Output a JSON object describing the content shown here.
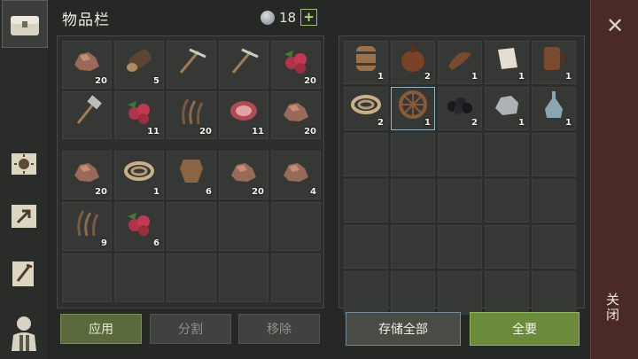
{
  "header": {
    "title": "物品栏",
    "currency_amount": "18",
    "add_label": "+"
  },
  "sidebar": {
    "tabs": [
      {
        "name": "inventory-chest"
      },
      {
        "name": "daily-sun"
      },
      {
        "name": "map-arrow"
      },
      {
        "name": "crafting-scroll"
      },
      {
        "name": "character"
      }
    ]
  },
  "left_top_slots": [
    {
      "item": "copper-ore-icon",
      "qty": "20"
    },
    {
      "item": "log-icon",
      "qty": "5"
    },
    {
      "item": "pickaxe-icon",
      "qty": ""
    },
    {
      "item": "pickaxe-icon",
      "qty": ""
    },
    {
      "item": "berries-icon",
      "qty": "20"
    },
    {
      "item": "hammer-icon",
      "qty": ""
    },
    {
      "item": "berries-icon",
      "qty": "11"
    },
    {
      "item": "plant-fiber-icon",
      "qty": "20"
    },
    {
      "item": "raw-meat-icon",
      "qty": "11"
    },
    {
      "item": "copper-ore-icon",
      "qty": "20"
    }
  ],
  "left_bottom_slots": [
    {
      "item": "copper-ore-icon",
      "qty": "20"
    },
    {
      "item": "rope-icon",
      "qty": "1"
    },
    {
      "item": "leather-icon",
      "qty": "6"
    },
    {
      "item": "copper-ore-icon",
      "qty": "20"
    },
    {
      "item": "copper-ore-icon",
      "qty": "4"
    },
    {
      "item": "plant-fiber-icon",
      "qty": "9"
    },
    {
      "item": "berries-icon",
      "qty": "6"
    },
    {
      "item": "",
      "qty": ""
    },
    {
      "item": "",
      "qty": ""
    },
    {
      "item": "",
      "qty": ""
    },
    {
      "item": "",
      "qty": ""
    },
    {
      "item": "",
      "qty": ""
    },
    {
      "item": "",
      "qty": ""
    },
    {
      "item": "",
      "qty": ""
    },
    {
      "item": "",
      "qty": ""
    }
  ],
  "right_slots": [
    {
      "item": "barrel-icon",
      "qty": "1"
    },
    {
      "item": "leather-flask-icon",
      "qty": "2"
    },
    {
      "item": "leather-strips-icon",
      "qty": "1"
    },
    {
      "item": "cloth-icon",
      "qty": "1"
    },
    {
      "item": "leather-mug-icon",
      "qty": "1"
    },
    {
      "item": "rope-icon",
      "qty": "2"
    },
    {
      "item": "wooden-wheel-icon",
      "qty": "1"
    },
    {
      "item": "coal-icon",
      "qty": "2"
    },
    {
      "item": "stone-icon",
      "qty": "1"
    },
    {
      "item": "glass-bottle-icon",
      "qty": "1"
    }
  ],
  "buttons": {
    "apply": "应用",
    "split": "分割",
    "remove": "移除",
    "store_all": "存储全部",
    "take_all": "全要"
  },
  "close": {
    "label": "关闭"
  },
  "colors": {
    "accent_green": "#6c8a3c",
    "close_bar": "#4a2a28",
    "slot_bg": "#353835"
  }
}
